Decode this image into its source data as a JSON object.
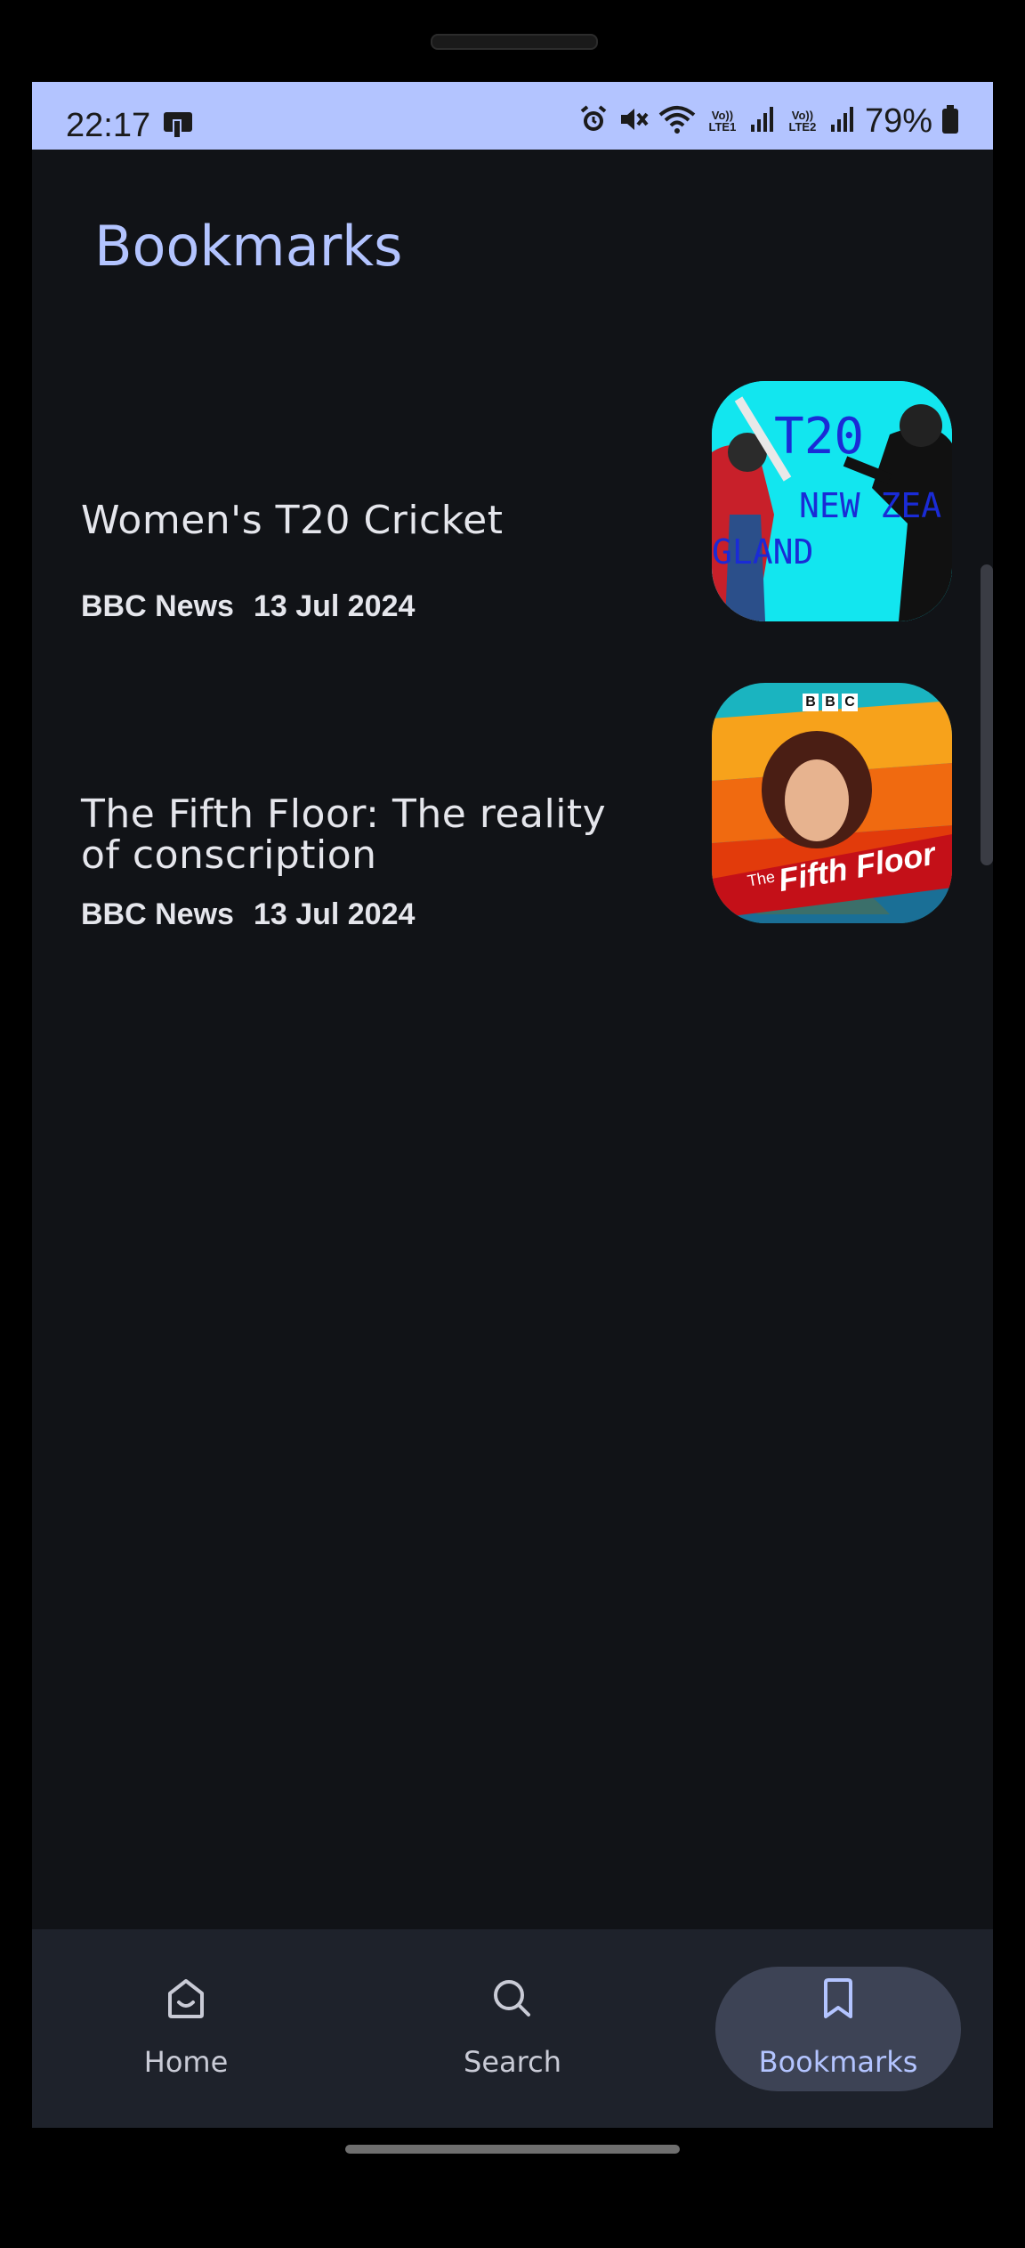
{
  "status_bar": {
    "time": "22:17",
    "battery": "79%",
    "sim1": "LTE1",
    "sim2": "LTE2",
    "volte": "Vo))"
  },
  "page": {
    "title": "Bookmarks"
  },
  "bookmarks": [
    {
      "title": "Women's T20 Cricket",
      "source": "BBC News",
      "date": "13 Jul 2024",
      "thumb_text": [
        "T20",
        "NEW ZEA",
        "GLAND"
      ]
    },
    {
      "title": "The Fifth Floor: The reality of conscription",
      "source": "BBC News",
      "date": "13 Jul 2024",
      "thumb_text": [
        "BBC",
        "The",
        "Fifth Floor"
      ]
    }
  ],
  "nav": {
    "home": "Home",
    "search": "Search",
    "bookmarks": "Bookmarks"
  },
  "colors": {
    "accent": "#b3c4ff",
    "background": "#111317",
    "nav_background": "#1e222b",
    "nav_active_pill": "#3d4355"
  }
}
